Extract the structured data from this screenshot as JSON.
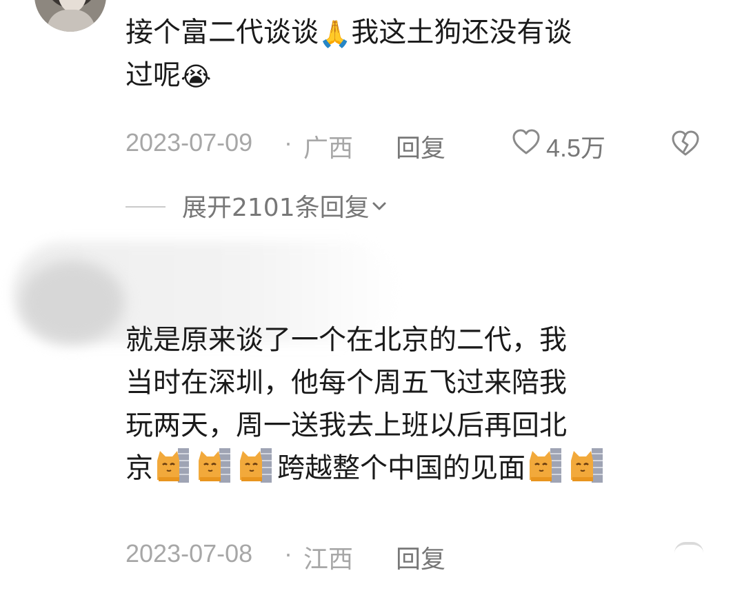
{
  "comment_1": {
    "text_line_1_part_a": "接个富二代谈谈",
    "text_line_1_emoji": "🙏",
    "text_line_1_part_b": "我这土狗还没有谈",
    "text_line_2_part_a": "过呢",
    "text_line_2_emoji": "😭",
    "date": "2023-07-09",
    "separator": "·",
    "location": "广西",
    "reply_label": "回复",
    "like_count": "4.5万",
    "expand_label": "展开2101条回复"
  },
  "comment_2": {
    "line_1": "就是原来谈了一个在北京的二代，我",
    "line_2": "当时在深圳，他每个周五飞过来陪我",
    "line_3": "玩两天，周一送我去上班以后再回北",
    "line_4_part_a": "京",
    "line_4_part_b": "跨越整个中国的见面",
    "date": "2023-07-08",
    "separator": "·",
    "location": "江西",
    "reply_label": "回复"
  },
  "colors": {
    "primary_text": "#1a1a1a",
    "meta_text": "#a7a7a7",
    "secondary_text": "#777777",
    "background": "#ffffff"
  },
  "icons": {
    "like": "heart-outline-icon",
    "dislike": "broken-heart-icon",
    "expand": "chevron-down-icon",
    "cat_emoji": "cat-peeking-wall-icon"
  }
}
